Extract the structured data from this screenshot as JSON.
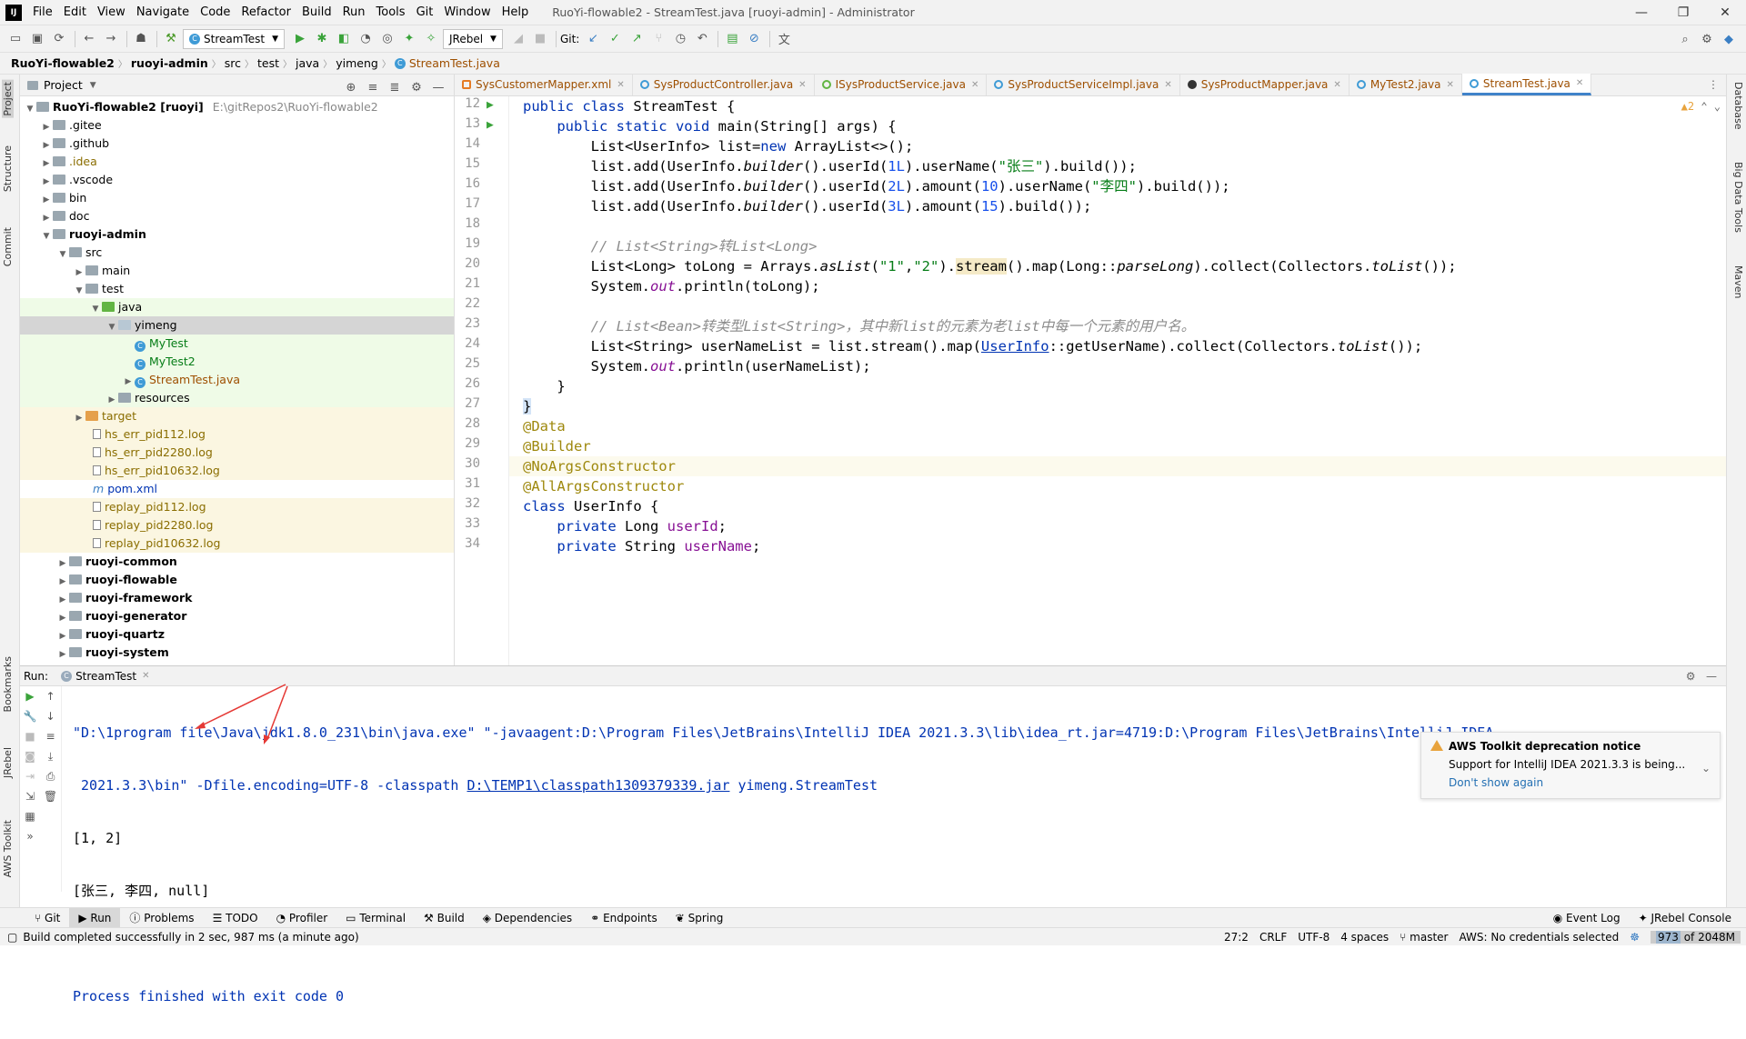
{
  "menubar": {
    "logo": "IJ",
    "items": [
      "File",
      "Edit",
      "View",
      "Navigate",
      "Code",
      "Refactor",
      "Build",
      "Run",
      "Tools",
      "Git",
      "Window",
      "Help"
    ],
    "title": "RuoYi-flowable2 - StreamTest.java [ruoyi-admin] - Administrator"
  },
  "toolbar": {
    "run_config": "StreamTest",
    "jrebel": "JRebel",
    "git_label": "Git:"
  },
  "breadcrumb": [
    "RuoYi-flowable2",
    "ruoyi-admin",
    "src",
    "test",
    "java",
    "yimeng",
    "StreamTest.java"
  ],
  "project": {
    "title": "Project",
    "root_name": "RuoYi-flowable2 [ruoyi]",
    "root_path": "E:\\gitRepos2\\RuoYi-flowable2",
    "items": [
      ".gitee",
      ".github",
      ".idea",
      ".vscode",
      "bin",
      "doc",
      "ruoyi-admin",
      "src",
      "main",
      "test",
      "java",
      "yimeng",
      "MyTest",
      "MyTest2",
      "StreamTest.java",
      "resources",
      "target",
      "hs_err_pid112.log",
      "hs_err_pid2280.log",
      "hs_err_pid10632.log",
      "pom.xml",
      "replay_pid112.log",
      "replay_pid2280.log",
      "replay_pid10632.log",
      "ruoyi-common",
      "ruoyi-flowable",
      "ruoyi-framework",
      "ruoyi-generator",
      "ruoyi-quartz",
      "ruoyi-system"
    ]
  },
  "tabs": [
    "SysCustomerMapper.xml",
    "SysProductController.java",
    "ISysProductService.java",
    "SysProductServiceImpl.java",
    "SysProductMapper.java",
    "MyTest2.java",
    "StreamTest.java"
  ],
  "editor": {
    "inspection": "▲2",
    "line_numbers": [
      "12",
      "13",
      "14",
      "15",
      "16",
      "17",
      "18",
      "19",
      "20",
      "21",
      "22",
      "23",
      "24",
      "25",
      "26",
      "27",
      "28",
      "29",
      "30",
      "31",
      "32",
      "33",
      "34"
    ]
  },
  "run": {
    "label": "Run:",
    "tab": "StreamTest",
    "console": {
      "cmd1": "\"D:\\1program file\\Java\\jdk1.8.0_231\\bin\\java.exe\" \"-javaagent:D:\\Program Files\\JetBrains\\IntelliJ IDEA 2021.3.3\\lib\\idea_rt.jar=4719:D:\\Program Files\\JetBrains\\IntelliJ IDEA",
      "cmd2a": " 2021.3.3\\bin\" -Dfile.encoding=UTF-8 -classpath ",
      "cmd2link": "D:\\TEMP1\\classpath1309379339.jar",
      "cmd2b": " yimeng.StreamTest",
      "out1": "[1, 2]",
      "out2": "[张三, 李四, null]",
      "exit": "Process finished with exit code 0"
    }
  },
  "aws": {
    "title": "AWS Toolkit deprecation notice",
    "body": "Support for IntelliJ IDEA 2021.3.3 is being...",
    "link": "Don't show again"
  },
  "left_strip": [
    "Project",
    "Structure",
    "Commit",
    "Bookmarks",
    "JRebel",
    "AWS Toolkit"
  ],
  "right_strip": [
    "Database",
    "Big Data Tools",
    "Maven"
  ],
  "bottom_tabs": [
    "Git",
    "Run",
    "Problems",
    "TODO",
    "Profiler",
    "Terminal",
    "Build",
    "Dependencies",
    "Endpoints",
    "Spring"
  ],
  "bottom_right_tabs": [
    "Event Log",
    "JRebel Console"
  ],
  "status": {
    "message": "Build completed successfully in 2 sec, 987 ms (a minute ago)",
    "position": "27:2",
    "line_sep": "CRLF",
    "encoding": "UTF-8",
    "indent": "4 spaces",
    "branch": "master",
    "aws": "AWS: No credentials selected",
    "memory_used": "973",
    "memory_total": "of 2048M"
  },
  "colors": {
    "accent": "#4083c9",
    "keyword": "#0033b3",
    "string": "#067d17",
    "annotation": "#9e880d",
    "test_green": "#62b543"
  }
}
